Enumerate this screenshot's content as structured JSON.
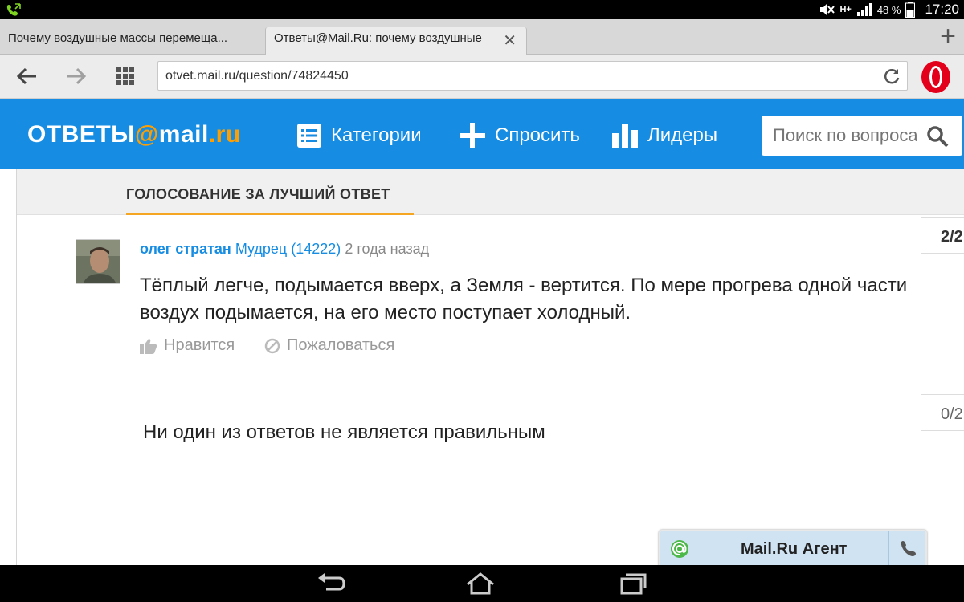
{
  "status_bar": {
    "network": "H+",
    "battery": "48 %",
    "time": "17:20"
  },
  "tabs": [
    {
      "title": "Почему воздушные массы перемеща...",
      "active": false
    },
    {
      "title": "Ответы@Mail.Ru: почему воздушные",
      "active": true
    }
  ],
  "address": {
    "url": "otvet.mail.ru/question/74824450"
  },
  "site": {
    "logo_prefix": "ОТВЕТЫ",
    "logo_at": "@",
    "logo_mail": "mail",
    "logo_dot": ".",
    "logo_ru": "ru",
    "nav": {
      "categories": "Категории",
      "ask": "Спросить",
      "leaders": "Лидеры"
    },
    "search_placeholder": "Поиск по вопросам"
  },
  "voting": {
    "title": "ГОЛОСОВАНИЕ ЗА ЛУЧШИЙ ОТВЕТ"
  },
  "answer": {
    "author": "олег стратан",
    "rank": "Мудрец (14222)",
    "time_ago": "2 года назад",
    "text": "Тёплый легче, подымается вверх, а Земля - вертится. По мере прогрева одной части воздух подымается, на его место поступает холодный.",
    "like_label": "Нравится",
    "report_label": "Пожаловаться",
    "votes": "2/2"
  },
  "none_option": {
    "text": "Ни один из ответов не является правильным",
    "votes": "0/2"
  },
  "agent": {
    "label": "Mail.Ru Агент"
  },
  "colors": {
    "header_blue": "#168de2",
    "accent_orange": "#f5a623",
    "link_blue": "#168de2"
  }
}
